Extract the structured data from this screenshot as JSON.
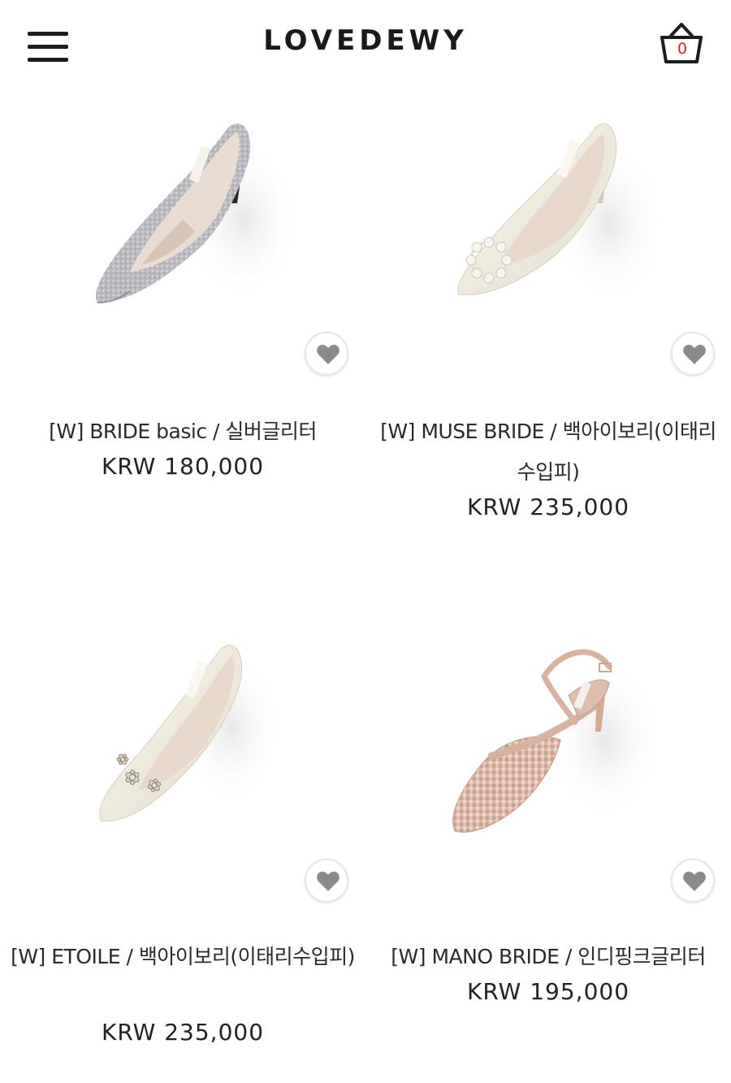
{
  "header": {
    "brand": "LOVEDEWY",
    "cart_count": "0",
    "menu_icon": "hamburger-menu-icon",
    "cart_icon": "basket-icon"
  },
  "products": [
    {
      "name": "[W]  BRIDE basic / 실버글리터",
      "price": "KRW 180,000",
      "image": "silver-glitter-pump",
      "wish_icon": "heart-icon"
    },
    {
      "name": "[W]  MUSE BRIDE / 백아이보리(이태리수입피)",
      "price": "KRW 235,000",
      "image": "ivory-pearl-buckle-pump",
      "wish_icon": "heart-icon"
    },
    {
      "name": "[W]  ETOILE / 백아이보리(이태리수입피)",
      "price": "KRW 235,000",
      "image": "ivory-flower-jewel-pump",
      "wish_icon": "heart-icon"
    },
    {
      "name": "[W]  MANO BRIDE / 인디핑크글리터",
      "price": "KRW 195,000",
      "image": "pink-glitter-slingback",
      "wish_icon": "heart-icon"
    }
  ],
  "colors": {
    "cart_count": "#d9232e",
    "text": "#222222",
    "wish_heart": "#8a8a8a"
  }
}
